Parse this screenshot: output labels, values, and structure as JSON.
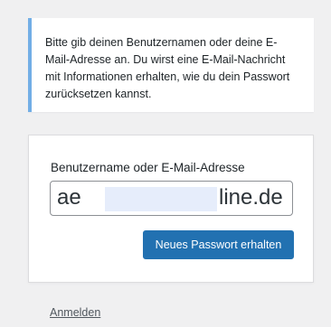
{
  "notice": {
    "text": "Bitte gib deinen Benutzernamen oder deine E-Mail-Adresse an. Du wirst eine E-Mail-Nachricht mit Informationen erhalten, wie du dein Passwort zurücksetzen kannst."
  },
  "form": {
    "label": "Benutzername oder E-Mail-Adresse",
    "value_prefix": "ae",
    "value_suffix": "line.de",
    "submit_label": "Neues Passwort erhalten"
  },
  "nav": {
    "login_label": "Anmelden"
  },
  "colors": {
    "accent": "#2271b1",
    "notice_border": "#72aee6",
    "background": "#f0f0f1"
  }
}
